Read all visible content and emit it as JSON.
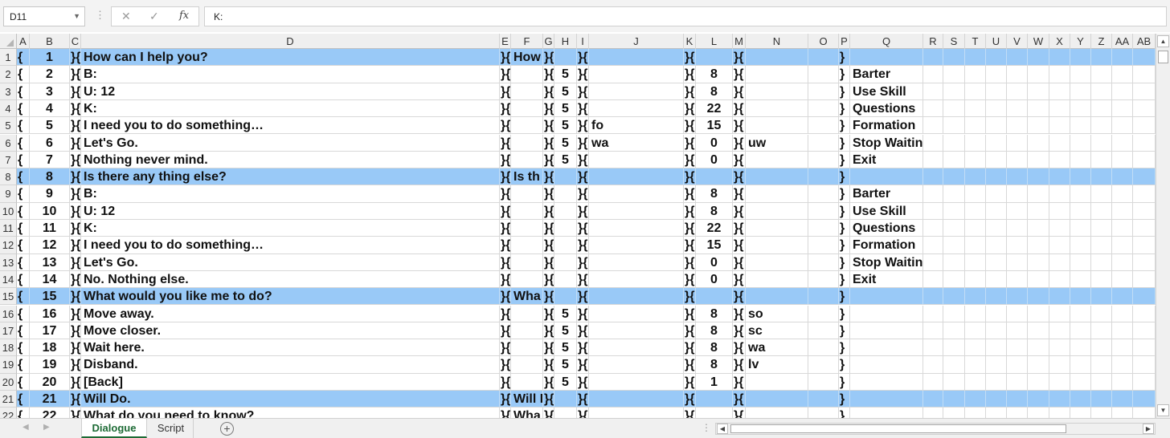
{
  "formula_bar": {
    "name_box": "D11",
    "separator": "⋮",
    "cancel_glyph": "✕",
    "enter_glyph": "✓",
    "fx_glyph": "fx",
    "formula": "K:"
  },
  "columns": [
    "A",
    "B",
    "C",
    "D",
    "E",
    "F",
    "G",
    "H",
    "I",
    "J",
    "K",
    "L",
    "M",
    "N",
    "O",
    "P",
    "Q",
    "R",
    "S",
    "T",
    "U",
    "V",
    "W",
    "X",
    "Y",
    "Z",
    "AA",
    "AB"
  ],
  "rows": [
    {
      "n": "1",
      "hl": true,
      "b": "1",
      "d": "How can I help you?",
      "f": "How",
      "h": "",
      "j": "",
      "l": "",
      "n2": "",
      "q": ""
    },
    {
      "n": "2",
      "hl": false,
      "b": "2",
      "d": "B:",
      "f": "",
      "h": "5",
      "j": "",
      "l": "8",
      "n2": "",
      "q": "Barter"
    },
    {
      "n": "3",
      "hl": false,
      "b": "3",
      "d": "U: 12",
      "f": "",
      "h": "5",
      "j": "",
      "l": "8",
      "n2": "",
      "q": "Use Skill"
    },
    {
      "n": "4",
      "hl": false,
      "b": "4",
      "d": "K:",
      "f": "",
      "h": "5",
      "j": "",
      "l": "22",
      "n2": "",
      "q": "Questions"
    },
    {
      "n": "5",
      "hl": false,
      "b": "5",
      "d": "I need you to do something…",
      "f": "",
      "h": "5",
      "j": "fo",
      "l": "15",
      "n2": "",
      "q": "Formation"
    },
    {
      "n": "6",
      "hl": false,
      "b": "6",
      "d": "Let's Go.",
      "f": "",
      "h": "5",
      "j": "wa",
      "l": "0",
      "n2": "uw",
      "q": "Stop Waiting"
    },
    {
      "n": "7",
      "hl": false,
      "b": "7",
      "d": "Nothing never mind.",
      "f": "",
      "h": "5",
      "j": "",
      "l": "0",
      "n2": "",
      "q": "Exit"
    },
    {
      "n": "8",
      "hl": true,
      "b": "8",
      "d": "Is there any thing else?",
      "f": "Is th",
      "h": "",
      "j": "",
      "l": "",
      "n2": "",
      "q": ""
    },
    {
      "n": "9",
      "hl": false,
      "b": "9",
      "d": "B:",
      "f": "",
      "h": "",
      "j": "",
      "l": "8",
      "n2": "",
      "q": "Barter"
    },
    {
      "n": "10",
      "hl": false,
      "b": "10",
      "d": "U: 12",
      "f": "",
      "h": "",
      "j": "",
      "l": "8",
      "n2": "",
      "q": "Use Skill"
    },
    {
      "n": "11",
      "hl": false,
      "b": "11",
      "d": "K:",
      "f": "",
      "h": "",
      "j": "",
      "l": "22",
      "n2": "",
      "q": "Questions"
    },
    {
      "n": "12",
      "hl": false,
      "b": "12",
      "d": "I need you to do something…",
      "f": "",
      "h": "",
      "j": "",
      "l": "15",
      "n2": "",
      "q": "Formation"
    },
    {
      "n": "13",
      "hl": false,
      "b": "13",
      "d": "Let's Go.",
      "f": "",
      "h": "",
      "j": "",
      "l": "0",
      "n2": "",
      "q": "Stop Waiting"
    },
    {
      "n": "14",
      "hl": false,
      "b": "14",
      "d": "No. Nothing else.",
      "f": "",
      "h": "",
      "j": "",
      "l": "0",
      "n2": "",
      "q": "Exit"
    },
    {
      "n": "15",
      "hl": true,
      "b": "15",
      "d": "What would you like me to do?",
      "f": "Wha",
      "h": "",
      "j": "",
      "l": "",
      "n2": "",
      "q": ""
    },
    {
      "n": "16",
      "hl": false,
      "b": "16",
      "d": "Move away.",
      "f": "",
      "h": "5",
      "j": "",
      "l": "8",
      "n2": "so",
      "q": ""
    },
    {
      "n": "17",
      "hl": false,
      "b": "17",
      "d": "Move closer.",
      "f": "",
      "h": "5",
      "j": "",
      "l": "8",
      "n2": "sc",
      "q": ""
    },
    {
      "n": "18",
      "hl": false,
      "b": "18",
      "d": "Wait here.",
      "f": "",
      "h": "5",
      "j": "",
      "l": "8",
      "n2": "wa",
      "q": ""
    },
    {
      "n": "19",
      "hl": false,
      "b": "19",
      "d": "Disband.",
      "f": "",
      "h": "5",
      "j": "",
      "l": "8",
      "n2": "lv",
      "q": ""
    },
    {
      "n": "20",
      "hl": false,
      "b": "20",
      "d": "[Back]",
      "f": "",
      "h": "5",
      "j": "",
      "l": "1",
      "n2": "",
      "q": ""
    },
    {
      "n": "21",
      "hl": true,
      "b": "21",
      "d": "Will Do.",
      "f": "Will I",
      "h": "",
      "j": "",
      "l": "",
      "n2": "",
      "q": ""
    },
    {
      "n": "22",
      "hl": false,
      "b": "22",
      "d": "What do you need to know?",
      "f": "Wha",
      "h": "",
      "j": "",
      "l": "",
      "n2": "",
      "q": ""
    }
  ],
  "glyphs": {
    "A": "{",
    "C": "}{",
    "E": "}{",
    "G": "}{",
    "I": "}{",
    "K": "}{",
    "M": "}{",
    "P": "}"
  },
  "sheet_tabs": [
    {
      "label": "Dialogue",
      "active": true
    },
    {
      "label": "Script",
      "active": false
    }
  ],
  "add_sheet_label": "+",
  "tabbar_dots": "⋮",
  "colors": {
    "highlight": "#99c9f7",
    "tab_active": "#1d6b35",
    "header_bg": "#efefef"
  }
}
